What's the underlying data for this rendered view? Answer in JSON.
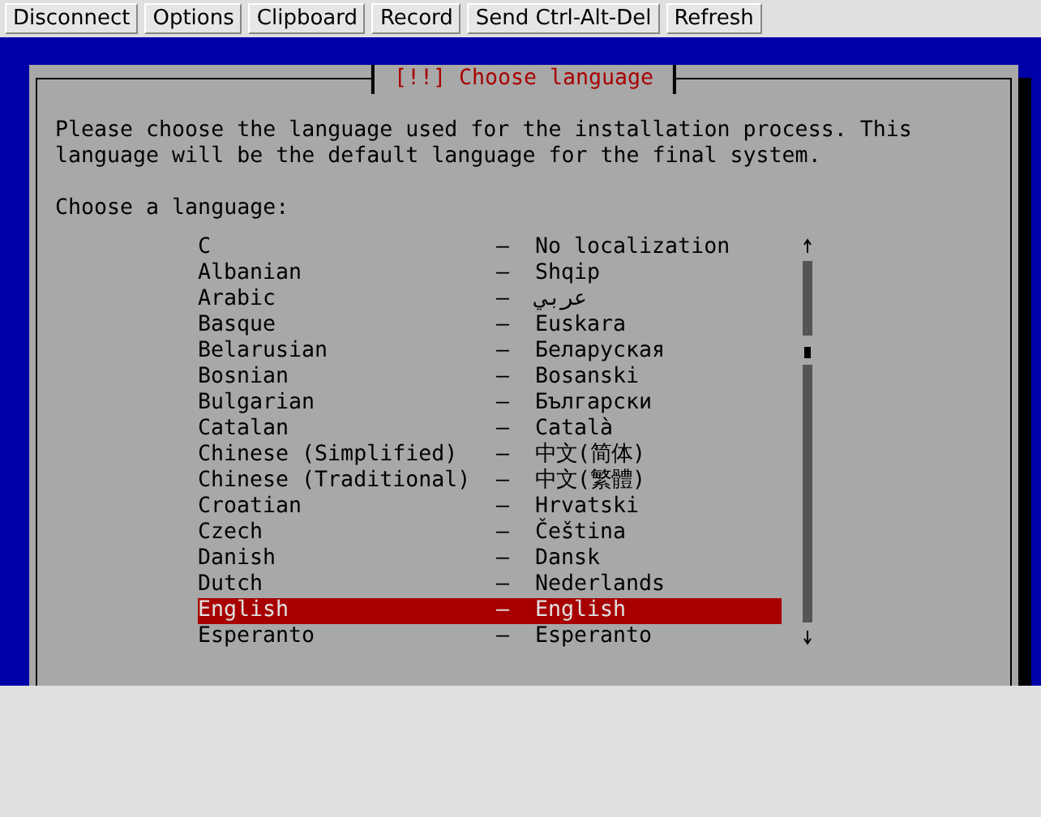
{
  "toolbar": {
    "buttons": [
      "Disconnect",
      "Options",
      "Clipboard",
      "Record",
      "Send Ctrl-Alt-Del",
      "Refresh"
    ]
  },
  "dialog": {
    "title": "[!!] Choose language",
    "description": "Please choose the language used for the installation process. This language will be the default language for the final system.",
    "prompt": "Choose a language:",
    "languages": [
      {
        "name": "C",
        "separator": "–",
        "native": "No localization",
        "selected": false
      },
      {
        "name": "Albanian",
        "separator": "–",
        "native": "Shqip",
        "selected": false
      },
      {
        "name": "Arabic",
        "separator": "–",
        "native": "عربي",
        "selected": false
      },
      {
        "name": "Basque",
        "separator": "–",
        "native": "Euskara",
        "selected": false
      },
      {
        "name": "Belarusian",
        "separator": "–",
        "native": "Беларуская",
        "selected": false
      },
      {
        "name": "Bosnian",
        "separator": "–",
        "native": "Bosanski",
        "selected": false
      },
      {
        "name": "Bulgarian",
        "separator": "–",
        "native": "Български",
        "selected": false
      },
      {
        "name": "Catalan",
        "separator": "–",
        "native": "Català",
        "selected": false
      },
      {
        "name": "Chinese (Simplified)",
        "separator": "–",
        "native": "中文(简体)",
        "selected": false
      },
      {
        "name": "Chinese (Traditional)",
        "separator": "–",
        "native": "中文(繁體)",
        "selected": false
      },
      {
        "name": "Croatian",
        "separator": "–",
        "native": "Hrvatski",
        "selected": false
      },
      {
        "name": "Czech",
        "separator": "–",
        "native": "Čeština",
        "selected": false
      },
      {
        "name": "Danish",
        "separator": "–",
        "native": "Dansk",
        "selected": false
      },
      {
        "name": "Dutch",
        "separator": "–",
        "native": "Nederlands",
        "selected": false
      },
      {
        "name": "English",
        "separator": "–",
        "native": "English",
        "selected": true
      },
      {
        "name": "Esperanto",
        "separator": "–",
        "native": "Esperanto",
        "selected": false
      }
    ]
  }
}
